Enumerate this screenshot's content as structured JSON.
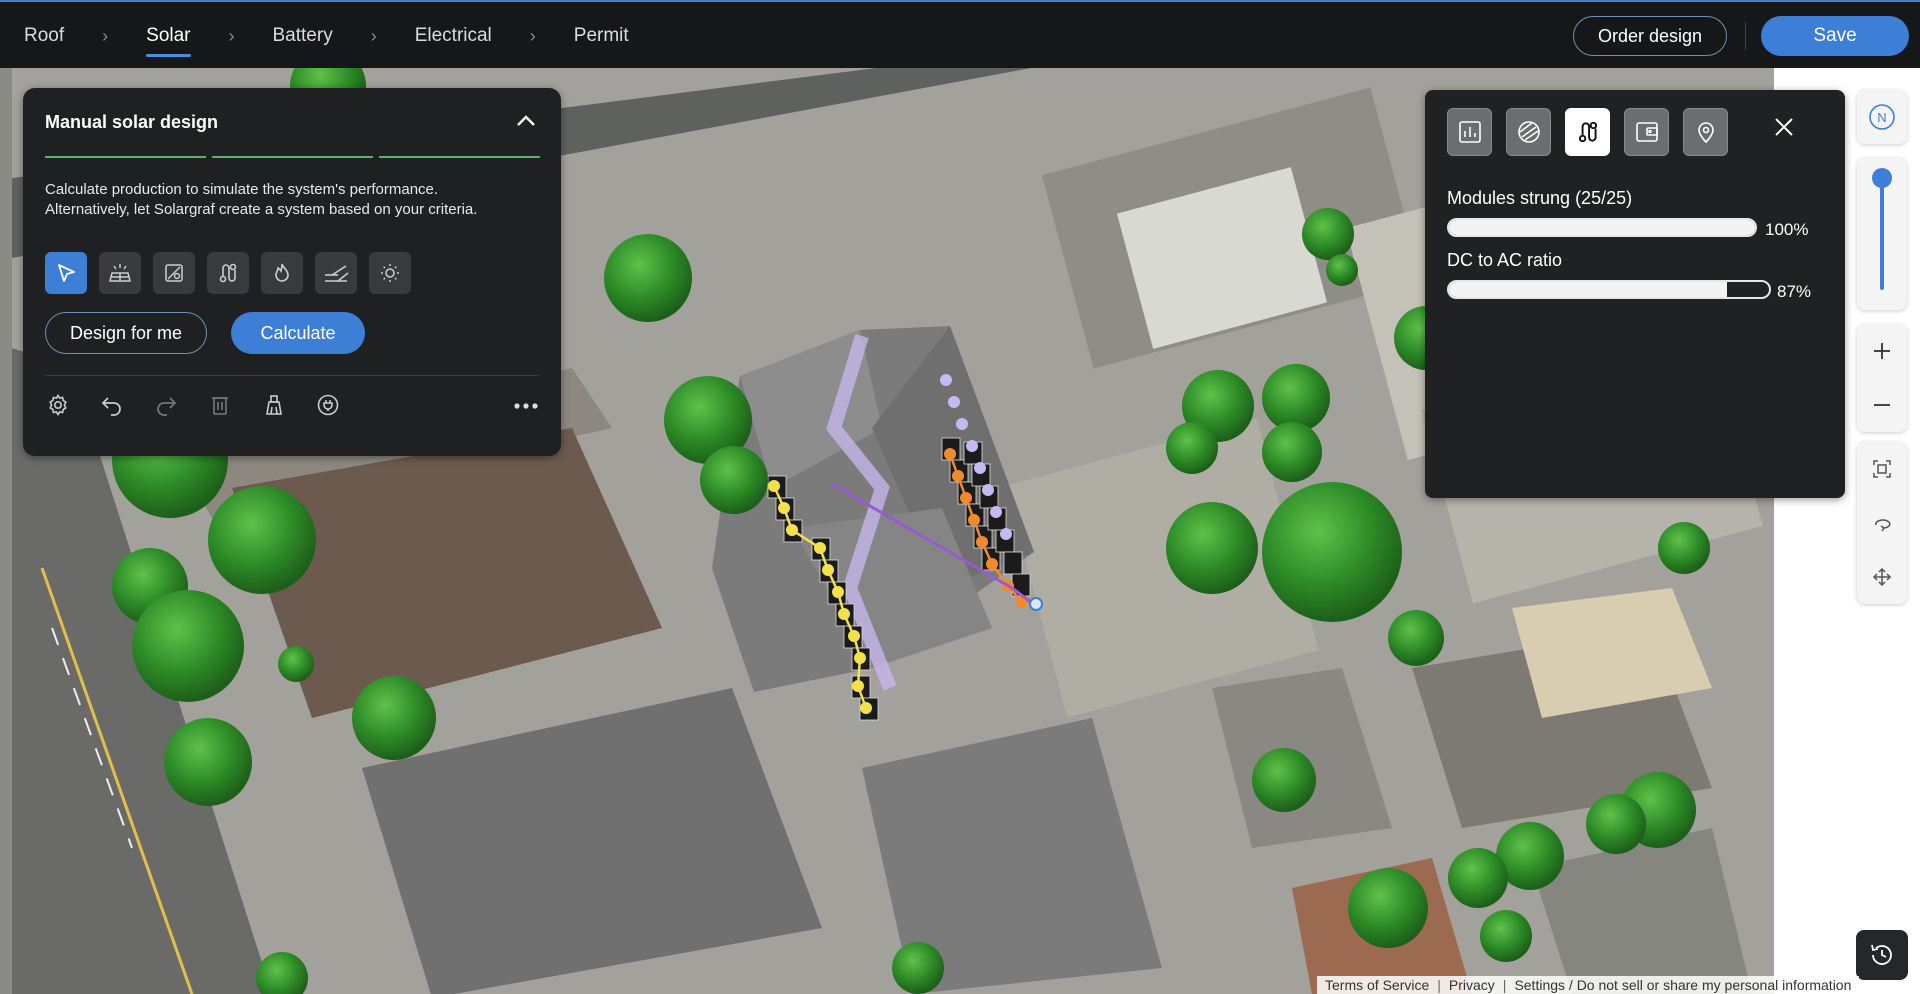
{
  "nav": {
    "steps": [
      {
        "label": "Roof"
      },
      {
        "label": "Solar"
      },
      {
        "label": "Battery"
      },
      {
        "label": "Electrical"
      },
      {
        "label": "Permit"
      }
    ],
    "active_step": "Solar",
    "order_label": "Order design",
    "save_label": "Save"
  },
  "left_panel": {
    "title": "Manual solar design",
    "description_line1": "Calculate production to simulate the system's performance.",
    "description_line2": "Alternatively, let Solargraf create a system based on your criteria.",
    "tools": [
      "select-icon",
      "module-icon",
      "obstruction-icon",
      "stringing-icon",
      "fire-setback-icon",
      "row-icon",
      "irradiance-icon"
    ],
    "design_for_me_label": "Design for me",
    "calculate_label": "Calculate",
    "bottom_tools": [
      "settings-icon",
      "undo-icon",
      "redo-icon",
      "delete-icon",
      "clear-icon",
      "plug-icon"
    ]
  },
  "right_panel": {
    "tabs": [
      "production-icon",
      "shading-icon",
      "stringing-icon",
      "wallet-icon",
      "location-icon"
    ],
    "modules_label": "Modules strung (25/25)",
    "modules_value": "100%",
    "modules_fraction": 1.0,
    "ratio_label": "DC to AC ratio",
    "ratio_value": "87%",
    "ratio_fraction": 0.87
  },
  "controls": {
    "compass_label": "N",
    "zoom_slider_fraction": 0.9
  },
  "footer": {
    "terms": "Terms of Service",
    "privacy": "Privacy",
    "settings": "Settings / Do not sell or share my personal information"
  },
  "colors": {
    "accent": "#3d7fd6",
    "panel_bg": "#1f2022",
    "string_yellow": "#f2e14a",
    "string_orange": "#f08a2c",
    "string_lavender": "#c7b8f0"
  }
}
